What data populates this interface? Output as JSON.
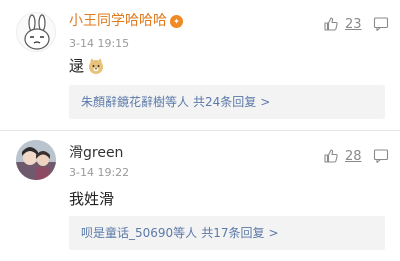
{
  "comments": [
    {
      "username": "小王同学哈哈哈",
      "time": "3-14 19:15",
      "likes": "23",
      "content": "逯",
      "reply_names": "朱顏辭鏡花辭樹等人",
      "reply_count": "共24条回复",
      "reply_arrow": ">",
      "badge_icon": "vip-badge-icon",
      "content_emoji": "doge-emoji-icon"
    },
    {
      "username": "滑green",
      "time": "3-14 19:22",
      "likes": "28",
      "content": "我姓滑",
      "reply_names": "呗是童话_50690等人",
      "reply_count": "共17条回复",
      "reply_arrow": ">"
    }
  ],
  "colors": {
    "username_highlight": "#e07a1f",
    "link_blue": "#5b7aa8",
    "meta_gray": "#9a9a9a",
    "reply_bg": "#f3f3f3"
  }
}
